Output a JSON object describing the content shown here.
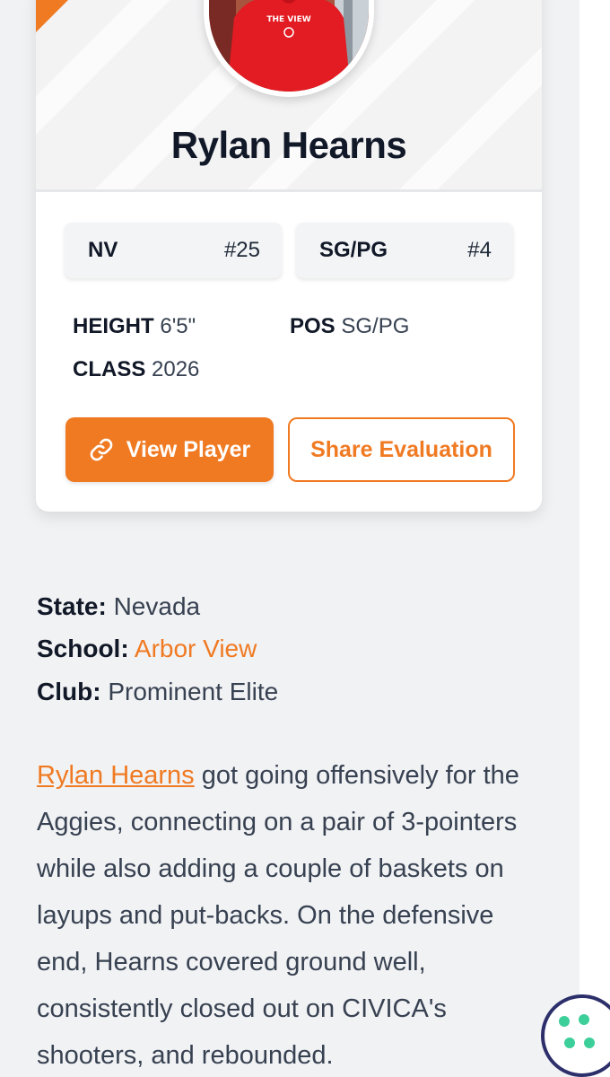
{
  "player": {
    "name": "Rylan Hearns",
    "state_abbr": "NV",
    "state_rank": "#25",
    "position_group": "SG/PG",
    "position_rank": "#4",
    "height_label": "HEIGHT",
    "height_value": "6'5\"",
    "pos_label": "POS",
    "pos_value": "SG/PG",
    "class_label": "CLASS",
    "class_value": "2026"
  },
  "actions": {
    "view_player": "View Player",
    "share_evaluation": "Share Evaluation"
  },
  "details": {
    "state_label": "State:",
    "state_value": "Nevada",
    "school_label": "School:",
    "school_value": "Arbor View",
    "club_label": "Club:",
    "club_value": "Prominent Elite"
  },
  "evaluation": {
    "player_link": "Rylan Hearns",
    "text": " got going offensively for the Aggies, connecting on a pair of 3-pointers while also adding a couple of baskets on layups and put-backs. On the defensive end, Hearns covered ground well, consistently closed out on CIVICA's shooters, and rebounded."
  },
  "colors": {
    "accent": "#f07a22",
    "cookie_border": "#2d2f6b",
    "cookie_dots": "#3ccf9a"
  }
}
